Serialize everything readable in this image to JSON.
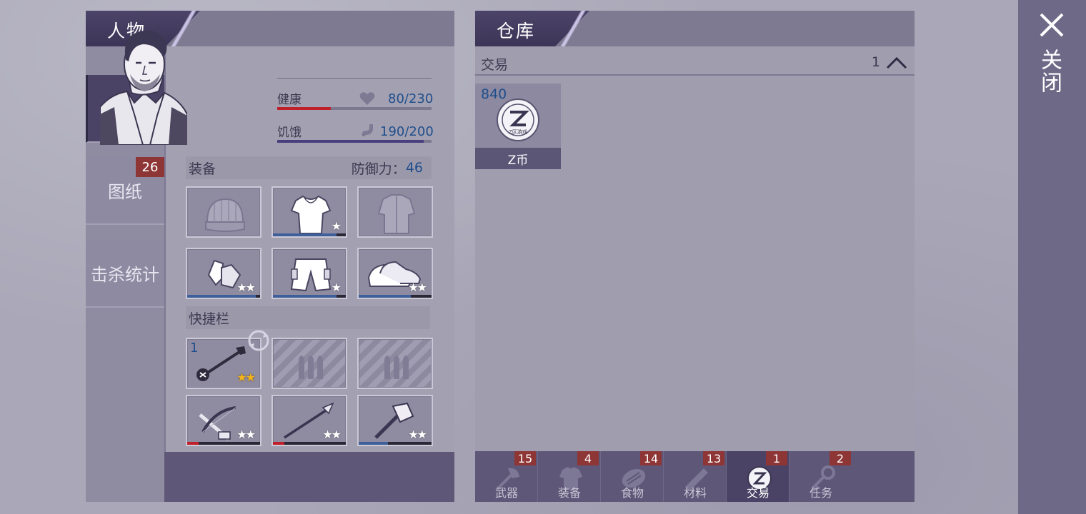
{
  "character": {
    "title": "人物",
    "tabs": [
      {
        "label": "装备",
        "badge": ""
      },
      {
        "label": "图纸",
        "badge": "26"
      },
      {
        "label": "击杀统计",
        "badge": ""
      }
    ],
    "stats": {
      "health": {
        "label": "健康",
        "value": "80/230",
        "fraction": 0.348,
        "color": "#c0202a"
      },
      "hunger": {
        "label": "饥饿",
        "value": "190/200",
        "fraction": 0.95,
        "color": "#4a3f7e"
      }
    },
    "equipment": {
      "label": "装备",
      "defense_label": "防御力：",
      "defense_value": "46",
      "slots": [
        {
          "item": "beanie-icon",
          "stars": "",
          "durability": 0
        },
        {
          "item": "hoodie-icon",
          "stars": "★",
          "durability": 0.87
        },
        {
          "item": "jacket-icon",
          "stars": "",
          "durability": 0
        },
        {
          "item": "gloves-icon",
          "stars": "★★",
          "durability": 0.94
        },
        {
          "item": "shorts-icon",
          "stars": "★",
          "durability": 0.87
        },
        {
          "item": "sneakers-icon",
          "stars": "★★",
          "durability": 0.72
        }
      ]
    },
    "hotbar": {
      "label": "快捷栏",
      "slots": [
        {
          "item": "pipe-wrench-icon",
          "count": "1",
          "stars": "★★",
          "star_color": "gold",
          "durability": 0
        },
        {
          "item": "ammo-placeholder-icon",
          "count": "",
          "stars": "",
          "star_color": "",
          "durability": 0
        },
        {
          "item": "ammo-placeholder-icon",
          "count": "",
          "stars": "",
          "star_color": "",
          "durability": 0
        },
        {
          "item": "crossbow-icon",
          "count": "",
          "stars": "★★",
          "star_color": "white",
          "durability": 0.16
        },
        {
          "item": "spear-icon",
          "count": "",
          "stars": "★★",
          "star_color": "white",
          "durability": 0.16
        },
        {
          "item": "sledgehammer-icon",
          "count": "",
          "stars": "★★",
          "star_color": "white",
          "durability": 0.4
        }
      ]
    }
  },
  "warehouse": {
    "title": "仓库",
    "category": {
      "label": "交易",
      "count": "1"
    },
    "items": [
      {
        "name": "Z币",
        "qty": "840",
        "icon": "z-coin-icon",
        "coin_text": "Z区游戏"
      }
    ],
    "tabs": [
      {
        "label": "武器",
        "badge": "15",
        "icon": "axe-icon"
      },
      {
        "label": "装备",
        "badge": "4",
        "icon": "shirt-icon"
      },
      {
        "label": "食物",
        "badge": "14",
        "icon": "food-icon"
      },
      {
        "label": "材料",
        "badge": "13",
        "icon": "material-icon"
      },
      {
        "label": "交易",
        "badge": "1",
        "icon": "z-coin-icon"
      },
      {
        "label": "任务",
        "badge": "2",
        "icon": "key-icon"
      }
    ]
  },
  "close": {
    "label": "关闭"
  },
  "colors": {
    "accent_dark": "#4a4366",
    "badge_red": "#8e3636",
    "value_blue": "#1f4e8c",
    "health_red": "#c0202a",
    "star_gold": "#f4b51c"
  }
}
